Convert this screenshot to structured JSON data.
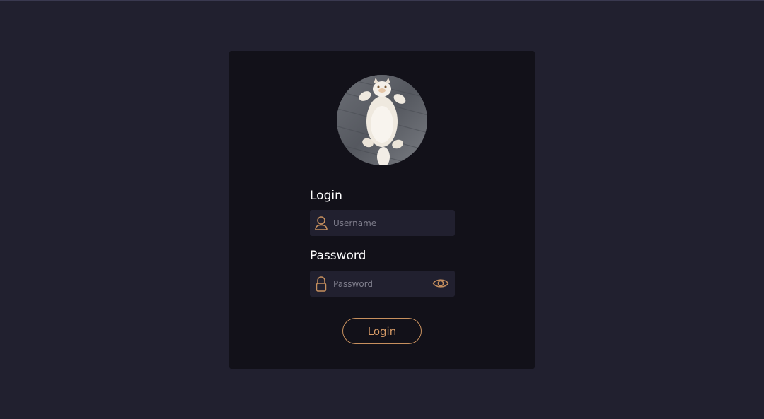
{
  "form": {
    "username_label": "Login",
    "username_placeholder": "Username",
    "password_label": "Password",
    "password_placeholder": "Password",
    "submit_label": "Login"
  },
  "icons": {
    "username": "user-icon",
    "password": "lock-icon",
    "toggle_visibility": "eye-icon"
  },
  "colors": {
    "page_background": "#21202f",
    "card_background": "#121119",
    "input_background": "#21202f",
    "accent": "#c7905e",
    "label_text": "#ffffff"
  }
}
